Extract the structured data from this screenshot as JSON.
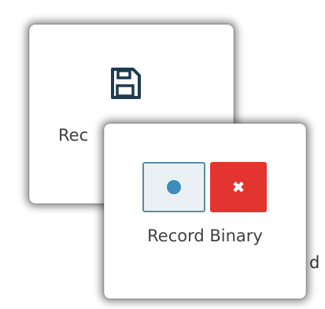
{
  "back_card": {
    "icon": "save-icon",
    "label": "Rec"
  },
  "front_card": {
    "record_button_icon": "circle-dot-icon",
    "cancel_button_icon": "close-icon",
    "cancel_glyph": "✖",
    "label": "Record Binary"
  },
  "background": {
    "text_fragment": "d"
  },
  "colors": {
    "record_dot": "#3c8dbc",
    "record_border": "#5b8aa3",
    "cancel_bg": "#e3342f",
    "icon_stroke": "#1f3b4d"
  }
}
